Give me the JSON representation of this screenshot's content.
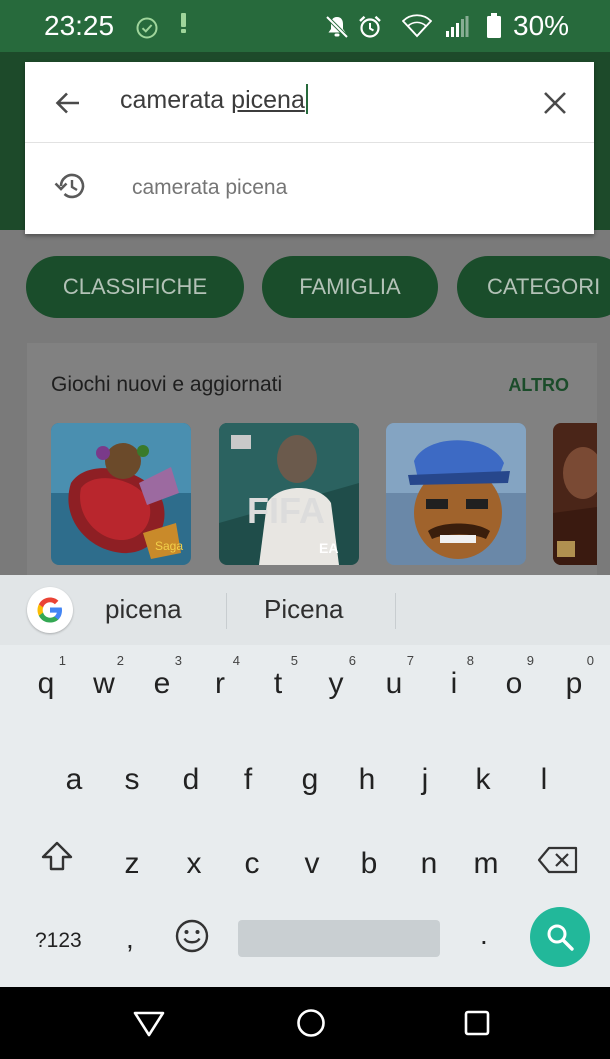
{
  "status_bar": {
    "time": "23:25",
    "battery_percent": "30%",
    "icons": [
      "check-circle-icon",
      "notification-alert-icon",
      "mute-icon",
      "alarm-icon",
      "wifi-icon",
      "signal-icon",
      "battery-icon"
    ],
    "bar_color": "#276a3c"
  },
  "search": {
    "query_prefix": "camerata ",
    "query_underlined": "picena",
    "history_suggestion": "camerata picena"
  },
  "background": {
    "chips": [
      "CLASSIFICHE",
      "FAMIGLIA",
      "CATEGORI"
    ],
    "section_title": "Giochi nuovi e aggiornati",
    "section_more": "ALTRO",
    "game_icons": [
      "candy-crush-icon",
      "fifa-icon",
      "clash-character-icon",
      "wrestling-icon"
    ]
  },
  "keyboard": {
    "suggestions": [
      "picena",
      "Picena"
    ],
    "row1": [
      {
        "key": "q",
        "hint": "1"
      },
      {
        "key": "w",
        "hint": "2"
      },
      {
        "key": "e",
        "hint": "3"
      },
      {
        "key": "r",
        "hint": "4"
      },
      {
        "key": "t",
        "hint": "5"
      },
      {
        "key": "y",
        "hint": "6"
      },
      {
        "key": "u",
        "hint": "7"
      },
      {
        "key": "i",
        "hint": "8"
      },
      {
        "key": "o",
        "hint": "9"
      },
      {
        "key": "p",
        "hint": "0"
      }
    ],
    "row2": [
      "a",
      "s",
      "d",
      "f",
      "g",
      "h",
      "j",
      "k",
      "l"
    ],
    "row3": [
      "z",
      "x",
      "c",
      "v",
      "b",
      "n",
      "m"
    ],
    "symbols_label": "?123",
    "comma": ",",
    "period": ".",
    "accent_color": "#22b89a"
  }
}
